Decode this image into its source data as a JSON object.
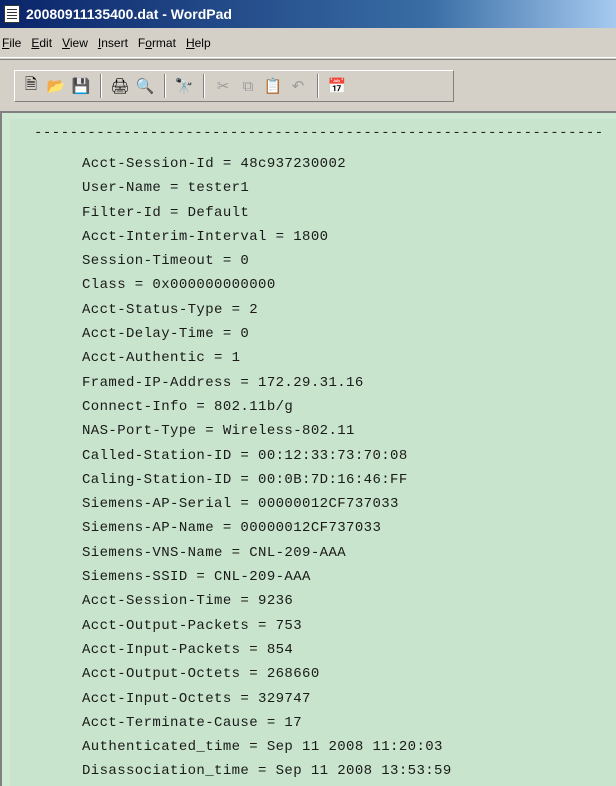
{
  "window": {
    "title": "20080911135400.dat - WordPad",
    "icon": "wordpad-document-icon"
  },
  "menu": [
    {
      "underline": "F",
      "rest": "ile"
    },
    {
      "underline": "E",
      "rest": "dit"
    },
    {
      "underline": "V",
      "rest": "iew"
    },
    {
      "underline": "I",
      "rest": "nsert"
    },
    {
      "prefix": "F",
      "underline": "o",
      "rest": "rmat"
    },
    {
      "underline": "H",
      "rest": "elp"
    }
  ],
  "toolbar": {
    "buttons": [
      "new-icon",
      "open-icon",
      "save-icon",
      "print-icon",
      "print-preview-icon",
      "find-icon",
      "cut-icon",
      "copy-icon",
      "paste-icon",
      "undo-icon",
      "date-time-icon"
    ],
    "disabled": [
      "cut-icon",
      "copy-icon",
      "undo-icon"
    ]
  },
  "document": {
    "rule": "----------------------------------------------------------------",
    "lines": [
      "Acct-Session-Id = 48c937230002",
      "User-Name = tester1",
      "Filter-Id = Default",
      "Acct-Interim-Interval = 1800",
      "Session-Timeout = 0",
      "Class = 0x000000000000",
      "Acct-Status-Type = 2",
      "Acct-Delay-Time = 0",
      "Acct-Authentic = 1",
      "Framed-IP-Address = 172.29.31.16",
      "Connect-Info = 802.11b/g",
      "NAS-Port-Type = Wireless-802.11",
      "Called-Station-ID = 00:12:33:73:70:08",
      "Caling-Station-ID = 00:0B:7D:16:46:FF",
      "Siemens-AP-Serial = 00000012CF737033",
      "Siemens-AP-Name = 00000012CF737033",
      "Siemens-VNS-Name = CNL-209-AAA",
      "Siemens-SSID = CNL-209-AAA",
      "Acct-Session-Time = 9236",
      "Acct-Output-Packets = 753",
      "Acct-Input-Packets = 854",
      "Acct-Output-Octets = 268660",
      "Acct-Input-Octets = 329747",
      "Acct-Terminate-Cause = 17",
      "Authenticated_time = Sep 11 2008 11:20:03",
      "Disassociation_time = Sep 11 2008 13:53:59"
    ],
    "background": "#c8e4cc"
  }
}
